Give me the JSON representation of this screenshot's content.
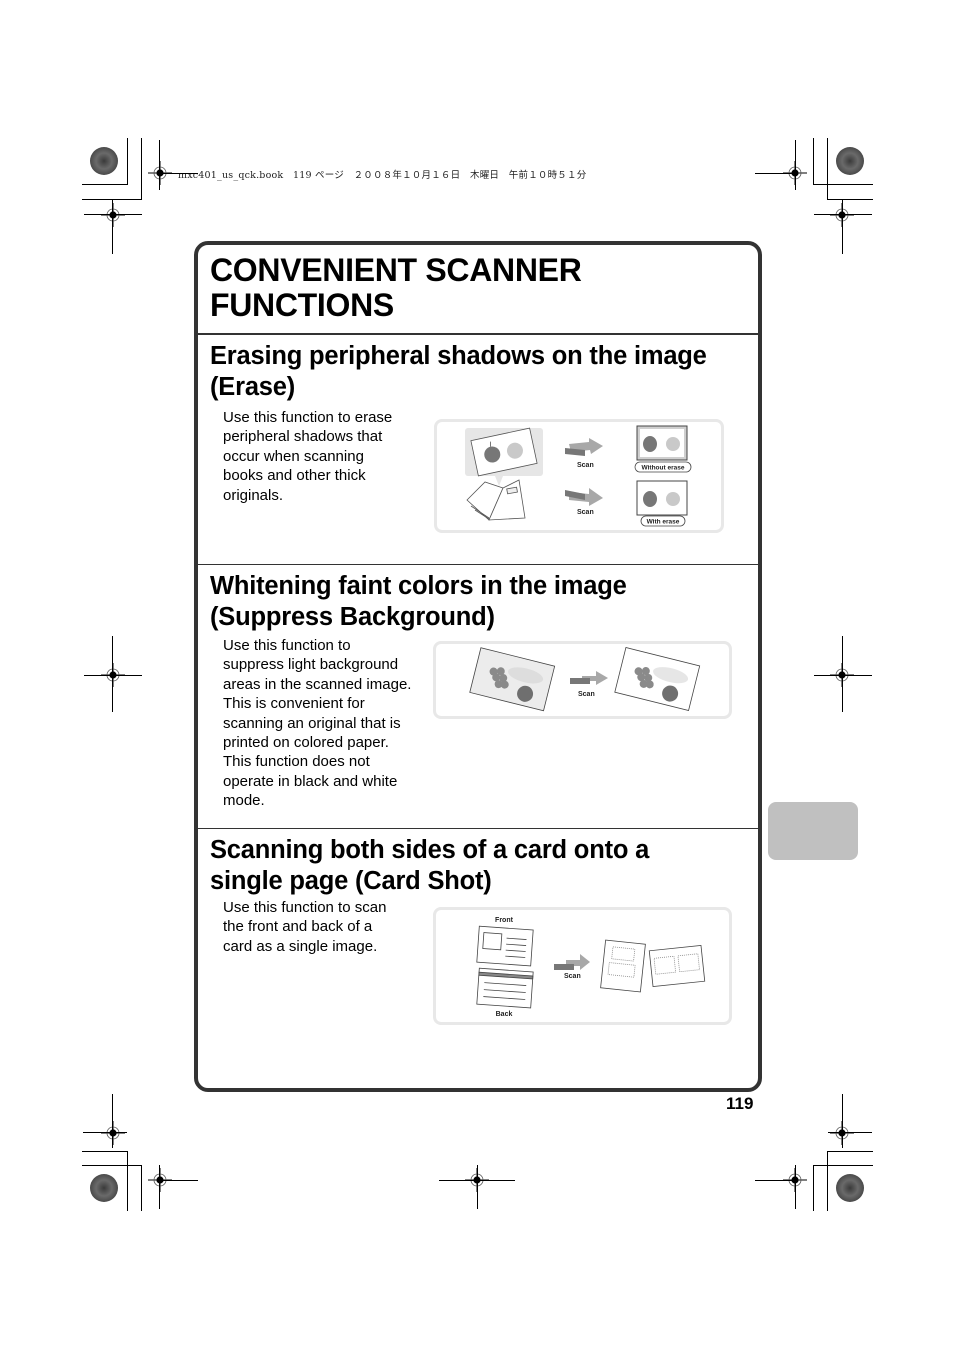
{
  "print_slug": {
    "filename": "mxc401_us_qck.book",
    "page": "119",
    "page_label_jp": "ページ",
    "date_jp": "２００８年１０月１６日　木曜日　午前１０時５１分"
  },
  "page": {
    "title_line1": "CONVENIENT SCANNER",
    "title_line2": "FUNCTIONS",
    "page_number": "119",
    "tab_color": "#c0c0c0",
    "frame_color": "#333333"
  },
  "sections": [
    {
      "heading_line1": "Erasing peripheral shadows on the image",
      "heading_line2": "(Erase)",
      "body": [
        "Use this function to erase",
        "peripheral shadows that",
        "occur when scanning",
        "books and other thick",
        "originals."
      ],
      "illustration": {
        "scan_label_top": "Scan",
        "scan_label_bottom": "Scan",
        "result_top_label": "Without erase",
        "result_bottom_label": "With erase"
      }
    },
    {
      "heading_line1": "Whitening faint colors in the image",
      "heading_line2": "(Suppress Background)",
      "body": [
        "Use this function to",
        "suppress light background",
        "areas in the scanned image.",
        "This is convenient for",
        "scanning an original that is",
        "printed on colored paper.",
        "This function does not",
        "operate in black and white",
        "mode."
      ],
      "illustration": {
        "scan_label": "Scan"
      }
    },
    {
      "heading_line1": "Scanning both sides of a card onto a",
      "heading_line2": "single page (Card Shot)",
      "body": [
        "Use this function to scan",
        "the front and back of a",
        "card as a single image."
      ],
      "illustration": {
        "front_label": "Front",
        "back_label": "Back",
        "scan_label": "Scan"
      }
    }
  ]
}
